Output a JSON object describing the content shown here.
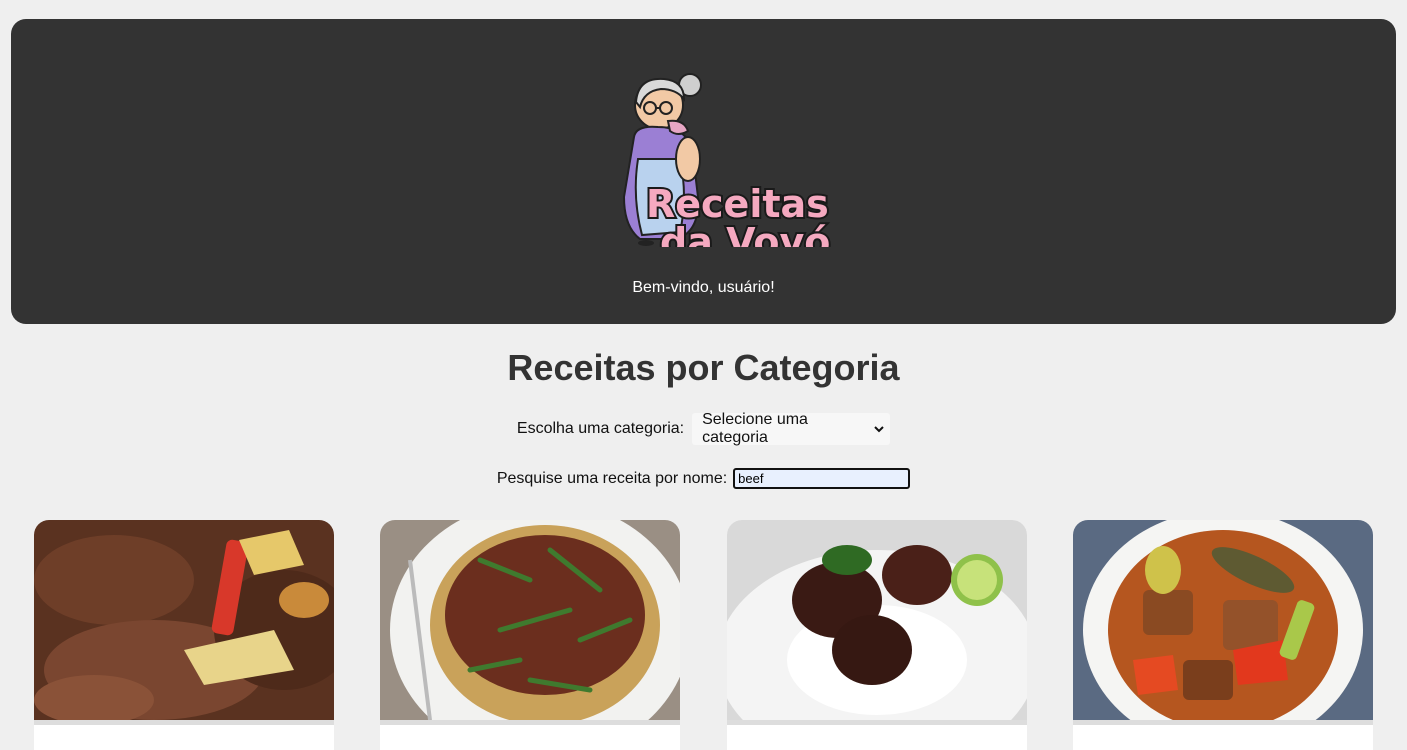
{
  "header": {
    "logo_line1": "Receitas",
    "logo_line2": "da Vovó",
    "welcome": "Bem-vindo, usuário!"
  },
  "main": {
    "title": "Receitas por Categoria",
    "category": {
      "label": "Escolha uma categoria:",
      "selected": "Selecione uma categoria"
    },
    "search": {
      "label": "Pesquise uma receita por nome:",
      "value": "beef"
    }
  },
  "recipes": [
    {
      "image": "beef-stew-with-peppers-photo"
    },
    {
      "image": "beef-stir-fry-asparagus-noodles-photo"
    },
    {
      "image": "beef-rendang-rice-lime-photo"
    },
    {
      "image": "beef-vegetable-stew-bowl-photo"
    }
  ],
  "colors": {
    "header_bg": "#333333",
    "page_bg": "#efefef",
    "logo_pink": "#f5a9c0"
  }
}
